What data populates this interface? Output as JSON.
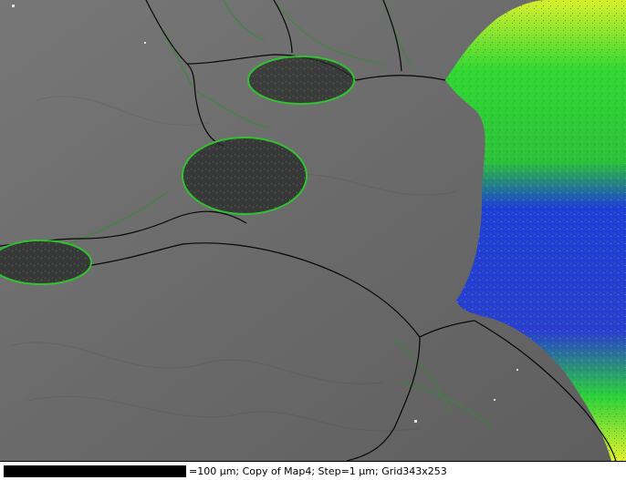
{
  "image": {
    "description": "EBSD micrograph overlay with grain boundaries and phase/orientation map",
    "palette": {
      "background_gray": "#6b6b6b",
      "boundary_black": "#000000",
      "boundary_green": "#2f8f2f",
      "map_green": "#33dd33",
      "map_blue": "#1f3fd6",
      "map_yellow": "#e6f020"
    }
  },
  "footer": {
    "caption": "=100 µm; Copy of Map4; Step=1 µm; Grid343x253"
  }
}
